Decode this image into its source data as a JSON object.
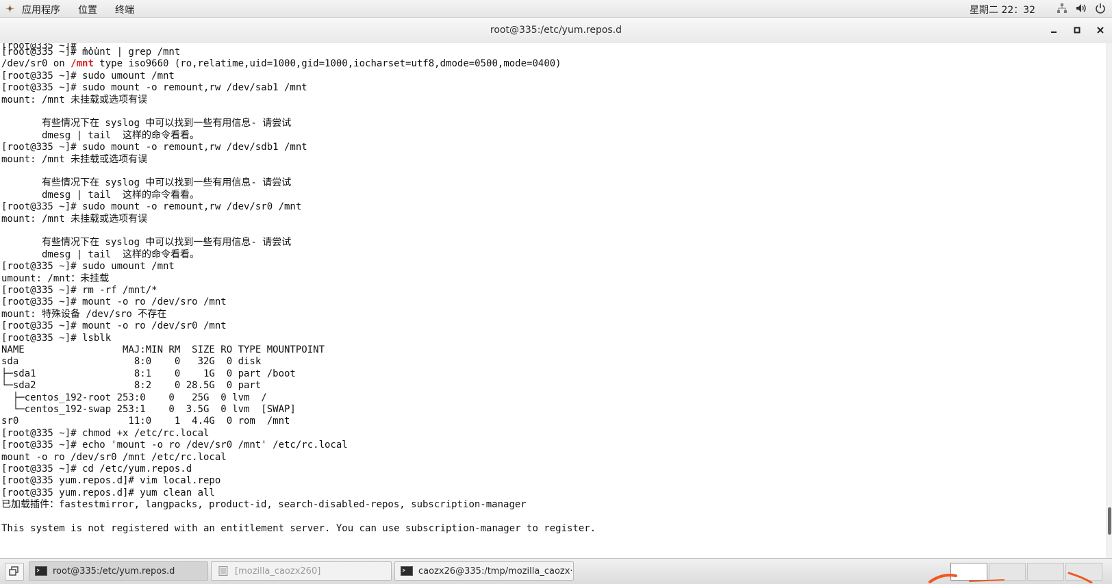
{
  "top_panel": {
    "applications": "应用程序",
    "places": "位置",
    "terminal": "终端",
    "clock": "星期二 22：32",
    "icons": [
      "apps-logo-icon",
      "network-icon",
      "volume-icon",
      "power-icon"
    ]
  },
  "window": {
    "title": "root@335:/etc/yum.repos.d",
    "buttons": [
      "minimize",
      "maximize",
      "close"
    ]
  },
  "terminal": {
    "lines": [
      "[root@335 ~]# mount | grep /mnt",
      "/dev/sr0 on /mnt type iso9660 (ro,relatime,uid=1000,gid=1000,iocharset=utf8,dmode=0500,mode=0400)",
      "[root@335 ~]# sudo umount /mnt",
      "[root@335 ~]# sudo mount -o remount,rw /dev/sab1 /mnt",
      "mount: /mnt 未挂载或选项有误",
      "",
      "       有些情况下在 syslog 中可以找到一些有用信息- 请尝试",
      "       dmesg | tail  这样的命令看看。",
      "[root@335 ~]# sudo mount -o remount,rw /dev/sdb1 /mnt",
      "mount: /mnt 未挂载或选项有误",
      "",
      "       有些情况下在 syslog 中可以找到一些有用信息- 请尝试",
      "       dmesg | tail  这样的命令看看。",
      "[root@335 ~]# sudo mount -o remount,rw /dev/sr0 /mnt",
      "mount: /mnt 未挂载或选项有误",
      "",
      "       有些情况下在 syslog 中可以找到一些有用信息- 请尝试",
      "       dmesg | tail  这样的命令看看。",
      "[root@335 ~]# sudo umount /mnt",
      "umount: /mnt：未挂载",
      "[root@335 ~]# rm -rf /mnt/*",
      "[root@335 ~]# mount -o ro /dev/sro /mnt",
      "mount: 特殊设备 /dev/sro 不存在",
      "[root@335 ~]# mount -o ro /dev/sr0 /mnt",
      "[root@335 ~]# lsblk",
      "NAME                 MAJ:MIN RM  SIZE RO TYPE MOUNTPOINT",
      "sda                    8:0    0   32G  0 disk",
      "├─sda1                 8:1    0    1G  0 part /boot",
      "└─sda2                 8:2    0 28.5G  0 part",
      "  ├─centos_192-root 253:0    0   25G  0 lvm  /",
      "  └─centos_192-swap 253:1    0  3.5G  0 lvm  [SWAP]",
      "sr0                   11:0    1  4.4G  0 rom  /mnt",
      "[root@335 ~]# chmod +x /etc/rc.local",
      "[root@335 ~]# echo 'mount -o ro /dev/sr0 /mnt' /etc/rc.local",
      "mount -o ro /dev/sr0 /mnt /etc/rc.local",
      "[root@335 ~]# cd /etc/yum.repos.d",
      "[root@335 yum.repos.d]# vim local.repo",
      "[root@335 yum.repos.d]# yum clean all",
      "已加载插件：fastestmirror, langpacks, product-id, search-disabled-repos, subscription-manager",
      "",
      "This system is not registered with an entitlement server. You can use subscription-manager to register."
    ],
    "highlight": {
      "line_index": 1,
      "before": "/dev/sr0 on ",
      "word": "/mnt",
      "after": " type iso9660 (ro,relatime,uid=1000,gid=1000,iocharset=utf8,dmode=0500,mode=0400)",
      "color": "#d81b1b"
    }
  },
  "taskbar": {
    "tasks": [
      {
        "label": "root@335:/etc/yum.repos.d",
        "icon": "terminal-icon",
        "active": true
      },
      {
        "label": "[mozilla_caozx260]",
        "icon": "file-manager-icon",
        "active": false
      },
      {
        "label": "caozx26@335:/tmp/mozilla_caozx···",
        "icon": "terminal-icon",
        "active": false
      }
    ],
    "workspaces": 4
  }
}
